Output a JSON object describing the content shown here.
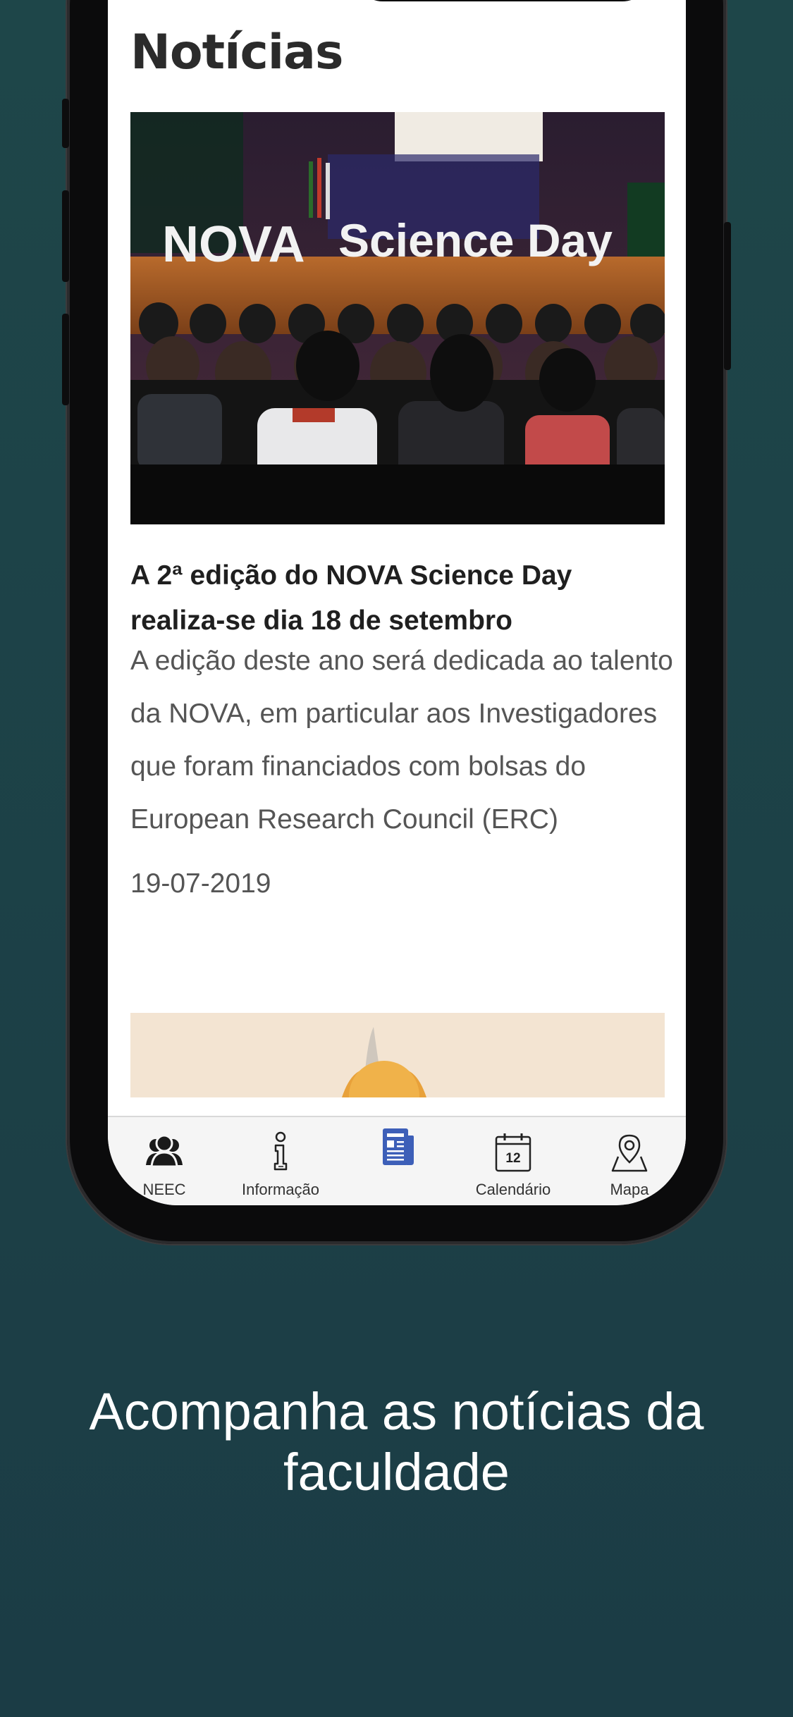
{
  "screen": {
    "title": "Notícias"
  },
  "news": [
    {
      "image": {
        "alt_text": "NOVA Science Day",
        "stage_word_1": "NOVA",
        "stage_word_2": "Science Day"
      },
      "headline": "A 2ª edição do NOVA Science Day realiza-se dia 18 de setembro",
      "summary": "A edição deste ano será dedicada ao talento da NOVA, em particular aos Investigadores que foram financiados com bolsas do European Research Council (ERC)",
      "date": "19-07-2019"
    }
  ],
  "tabbar": {
    "active_color": "#3d5fb8",
    "items": [
      {
        "label": "NEEC",
        "icon": "people-icon"
      },
      {
        "label": "Informação",
        "icon": "info-icon"
      },
      {
        "label": "",
        "icon": "newspaper-icon",
        "active": true
      },
      {
        "label": "Calendário",
        "icon": "calendar-icon",
        "day": "12"
      },
      {
        "label": "Mapa",
        "icon": "map-pin-icon"
      }
    ]
  },
  "caption": "Acompanha as notícias da faculdade"
}
